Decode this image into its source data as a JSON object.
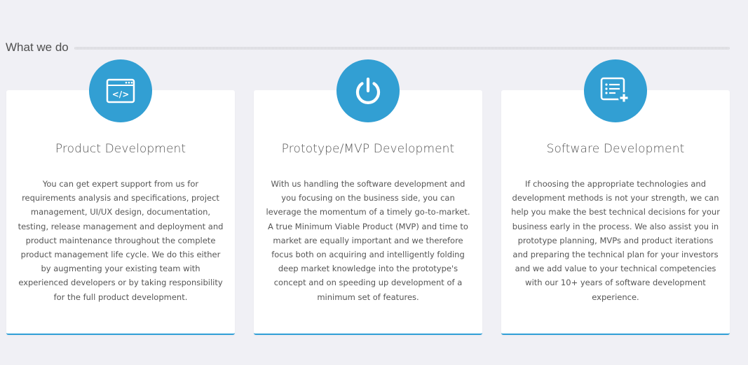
{
  "section": {
    "title": "What we do"
  },
  "colors": {
    "accent": "#329fd3",
    "background": "#f0f0f5",
    "card": "#ffffff",
    "text": "#555555"
  },
  "cards": [
    {
      "icon": "code-window-icon",
      "title": "Product Development",
      "text": "You can get expert support from us for requirements analysis and specifications, project management, UI/UX design, documentation, testing, release management and deployment and product maintenance throughout the complete product management life cycle. We do this either by augmenting your existing team with experienced developers or by taking responsibility for the full product development."
    },
    {
      "icon": "power-icon",
      "title": "Prototype/MVP Development",
      "text": "With us handling the software development and you focusing on the business side, you can leverage the momentum of a timely go-to-market. A true Minimum Viable Product (MVP) and time to market are equally important and we therefore focus both on acquiring and intelligently folding deep market knowledge into the prototype's concept and on speeding up development of a minimum set of features."
    },
    {
      "icon": "list-add-icon",
      "title": "Software Development",
      "text": "If choosing the appropriate technologies and development methods is not your strength, we can help you make the best technical decisions for your business early in the process. We also assist you in prototype planning, MVPs and product iterations and preparing the technical plan for your investors and we add value to your technical competencies with our 10+ years of software development experience."
    }
  ]
}
